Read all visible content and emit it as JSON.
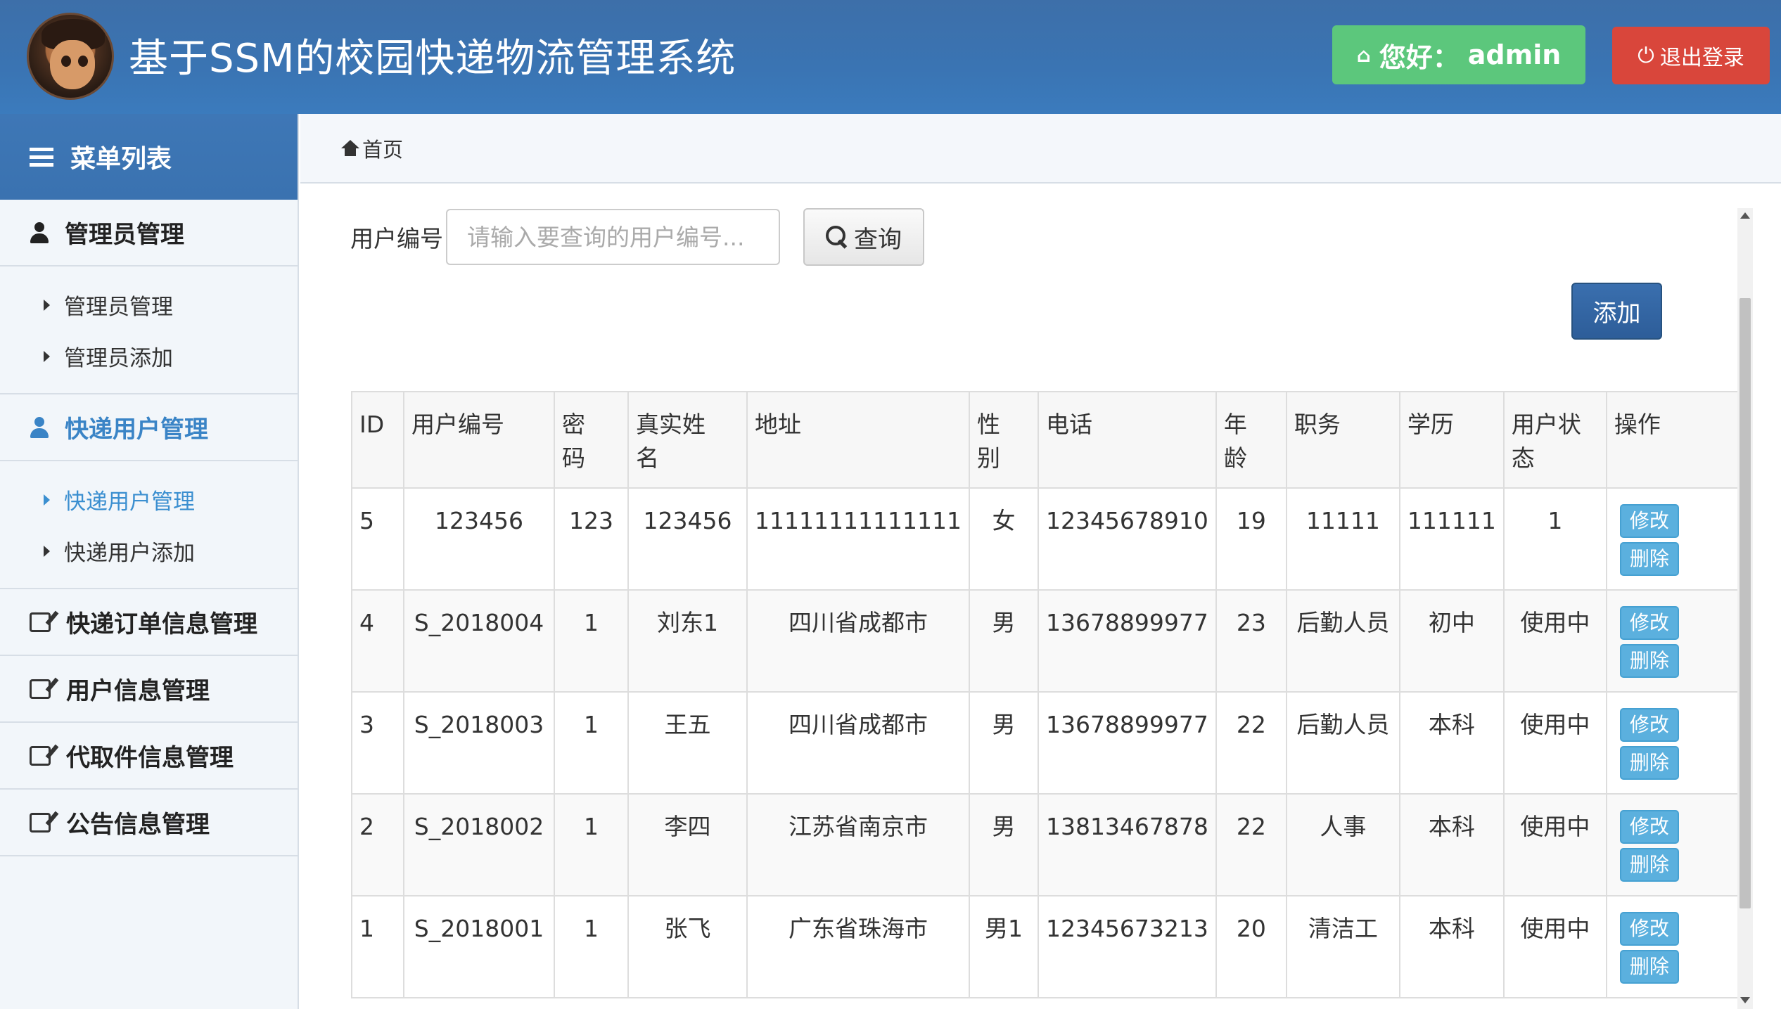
{
  "header": {
    "title": "基于SSM的校园快递物流管理系统",
    "greeting": "您好：",
    "username": "admin",
    "logout_label": "退出登录"
  },
  "sidebar": {
    "menu_title": "菜单列表",
    "sections": [
      {
        "label": "管理员管理",
        "icon": "user-icon",
        "active": false,
        "items": [
          {
            "label": "管理员管理",
            "active": false
          },
          {
            "label": "管理员添加",
            "active": false
          }
        ]
      },
      {
        "label": "快递用户管理",
        "icon": "user-icon",
        "active": true,
        "items": [
          {
            "label": "快递用户管理",
            "active": true
          },
          {
            "label": "快递用户添加",
            "active": false
          }
        ]
      },
      {
        "label": "快递订单信息管理",
        "icon": "edit-icon",
        "active": false,
        "items": []
      },
      {
        "label": "用户信息管理",
        "icon": "edit-icon",
        "active": false,
        "items": []
      },
      {
        "label": "代取件信息管理",
        "icon": "edit-icon",
        "active": false,
        "items": []
      },
      {
        "label": "公告信息管理",
        "icon": "edit-icon",
        "active": false,
        "items": []
      }
    ]
  },
  "breadcrumb": {
    "home": "首页"
  },
  "search": {
    "label": "用户编号",
    "placeholder": "请输入要查询的用户编号...",
    "value": "",
    "button": "查询"
  },
  "add_button": "添加",
  "table": {
    "headers": [
      "ID",
      "用户编号",
      "密\n码",
      "真实姓\n名",
      "地址",
      "性\n别",
      "电话",
      "年\n龄",
      "职务",
      "学历",
      "用户状\n态",
      "操作"
    ],
    "rows": [
      [
        "5",
        "123456",
        "123",
        "123456",
        "11111111111111",
        "女",
        "12345678910",
        "19",
        "11111",
        "111111",
        "1"
      ],
      [
        "4",
        "S_2018004",
        "1",
        "刘东1",
        "四川省成都市",
        "男",
        "13678899977",
        "23",
        "后勤人员",
        "初中",
        "使用中"
      ],
      [
        "3",
        "S_2018003",
        "1",
        "王五",
        "四川省成都市",
        "男",
        "13678899977",
        "22",
        "后勤人员",
        "本科",
        "使用中"
      ],
      [
        "2",
        "S_2018002",
        "1",
        "李四",
        "江苏省南京市",
        "男",
        "13813467878",
        "22",
        "人事",
        "本科",
        "使用中"
      ],
      [
        "1",
        "S_2018001",
        "1",
        "张飞",
        "广东省珠海市",
        "男1",
        "12345673213",
        "20",
        "清洁工",
        "本科",
        "使用中"
      ]
    ],
    "actions": {
      "edit": "修改",
      "delete": "删除"
    }
  },
  "colors": {
    "header_bg": "#3a74b3",
    "greet_bg": "#5cc77c",
    "logout_bg": "#d9463b",
    "active_link": "#3b8fd0",
    "add_btn": "#2d5d99",
    "op_btn": "#5bb0de"
  }
}
